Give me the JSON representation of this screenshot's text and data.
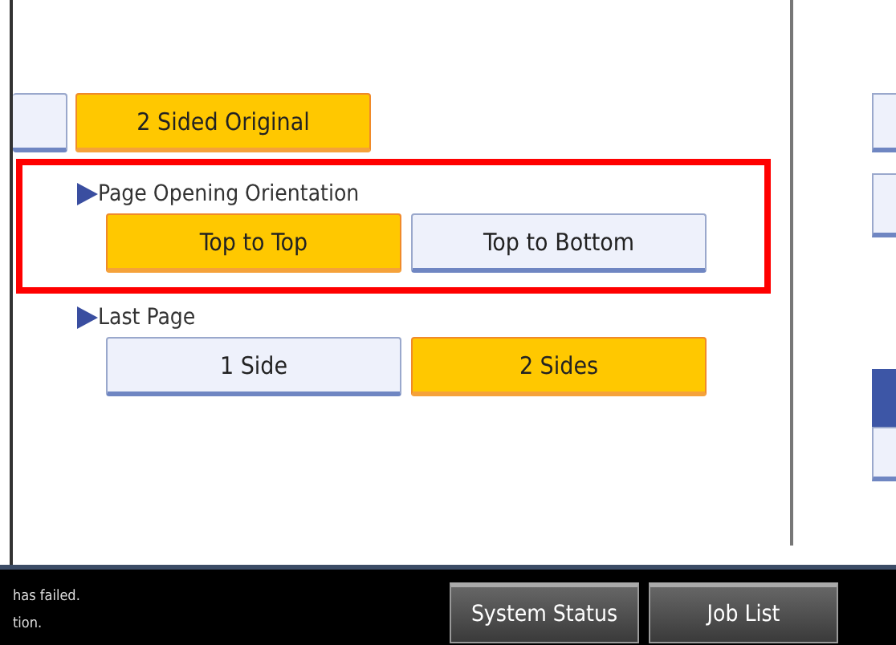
{
  "top_row": [
    {
      "selected": false
    },
    {
      "label": "2 Sided Original",
      "selected": true
    }
  ],
  "sections": [
    {
      "heading": "Page Opening Orientation",
      "highlighted": true,
      "options": [
        {
          "label": "Top to Top",
          "selected": true
        },
        {
          "label": "Top to Bottom",
          "selected": false
        }
      ]
    },
    {
      "heading": "Last Page",
      "highlighted": false,
      "options": [
        {
          "label": "1 Side",
          "selected": false
        },
        {
          "label": "2 Sides",
          "selected": true
        }
      ]
    }
  ],
  "right_buttons": [
    {
      "selected": false
    },
    {
      "selected": false
    },
    {
      "selected": true
    },
    {
      "selected": false
    }
  ],
  "status_messages": [
    "has failed.",
    "tion."
  ],
  "footer_buttons": [
    "System Status",
    "Job List"
  ]
}
